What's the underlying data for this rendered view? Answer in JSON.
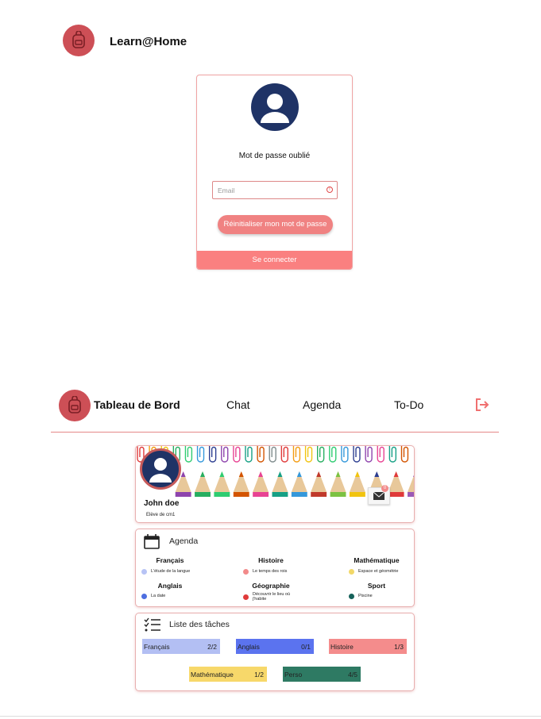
{
  "brand": {
    "name": "Learn@Home",
    "icon": "backpack-icon",
    "color": "#cd4f56"
  },
  "forgot_card": {
    "title": "Mot de passe oublié",
    "email_placeholder": "Email",
    "reset_button": "Réinitialiser mon mot de passe",
    "connect_link": "Se connecter",
    "accent": "#fa8080"
  },
  "nav": {
    "title": "Tableau de Bord",
    "links": [
      "Chat",
      "Agenda",
      "To-Do"
    ],
    "logout_icon": "logout-icon"
  },
  "profile": {
    "name": "John doe",
    "role": "Elève de cm1",
    "mail_badge": "0"
  },
  "agenda": {
    "title": "Agenda",
    "subjects": [
      {
        "name": "Français",
        "item": "L'étude de la langue",
        "color": "#b7c3f5"
      },
      {
        "name": "Histoire",
        "item": "Le temps des rois",
        "color": "#f28a8a"
      },
      {
        "name": "Mathématique",
        "item": "Espace et géométrie",
        "color": "#f2d868"
      },
      {
        "name": "Anglais",
        "item": "La date",
        "color": "#4d6ee0"
      },
      {
        "name": "Géographie",
        "item": "Découvrir le lieu où j'habite",
        "color": "#e03a3a"
      },
      {
        "name": "Sport",
        "item": "Piscine",
        "color": "#16625a"
      }
    ]
  },
  "tasks": {
    "title": "Liste des tâches",
    "items": [
      {
        "name": "Français",
        "count": "2/2",
        "color": "#b3bff3"
      },
      {
        "name": "Anglais",
        "count": "0/1",
        "color": "#5b73ef"
      },
      {
        "name": "Histoire",
        "count": "1/3",
        "color": "#f48c8c"
      },
      {
        "name": "Mathématique",
        "count": "1/2",
        "color": "#f7d86a"
      },
      {
        "name": "Perso",
        "count": "4/5",
        "color": "#2e7a63"
      }
    ]
  }
}
